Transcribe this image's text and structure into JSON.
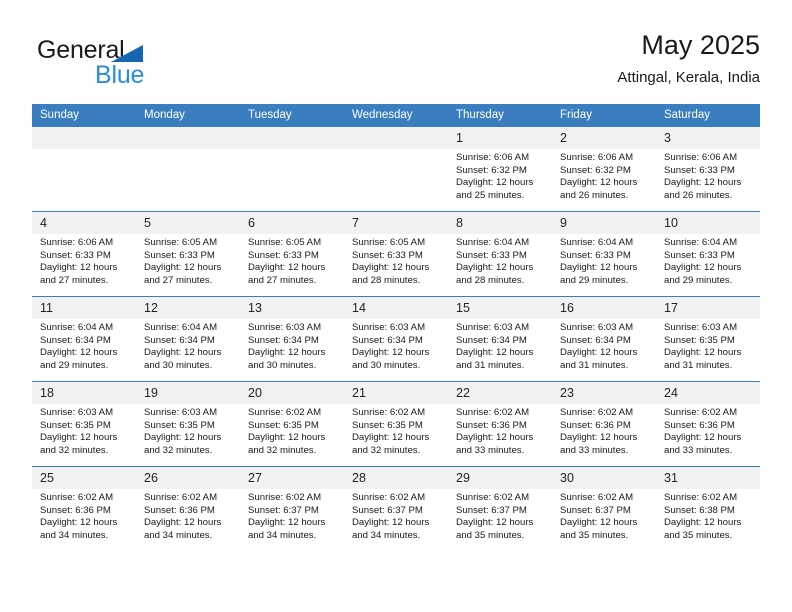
{
  "brand": {
    "name_top": "General",
    "name_bottom": "Blue",
    "accent_color": "#2a8ddb",
    "triangle_color": "#1565b0"
  },
  "header": {
    "title": "May 2025",
    "location": "Attingal, Kerala, India"
  },
  "calendar": {
    "header_bg": "#3a7ebf",
    "header_text_color": "#ffffff",
    "daynum_bg": "#f2f2f2",
    "weekdays": [
      "Sunday",
      "Monday",
      "Tuesday",
      "Wednesday",
      "Thursday",
      "Friday",
      "Saturday"
    ],
    "weeks": [
      [
        {
          "day": "",
          "empty": true
        },
        {
          "day": "",
          "empty": true
        },
        {
          "day": "",
          "empty": true
        },
        {
          "day": "",
          "empty": true
        },
        {
          "day": "1",
          "sunrise": "Sunrise: 6:06 AM",
          "sunset": "Sunset: 6:32 PM",
          "daylight_line1": "Daylight: 12 hours",
          "daylight_line2": "and 25 minutes."
        },
        {
          "day": "2",
          "sunrise": "Sunrise: 6:06 AM",
          "sunset": "Sunset: 6:32 PM",
          "daylight_line1": "Daylight: 12 hours",
          "daylight_line2": "and 26 minutes."
        },
        {
          "day": "3",
          "sunrise": "Sunrise: 6:06 AM",
          "sunset": "Sunset: 6:33 PM",
          "daylight_line1": "Daylight: 12 hours",
          "daylight_line2": "and 26 minutes."
        }
      ],
      [
        {
          "day": "4",
          "sunrise": "Sunrise: 6:06 AM",
          "sunset": "Sunset: 6:33 PM",
          "daylight_line1": "Daylight: 12 hours",
          "daylight_line2": "and 27 minutes."
        },
        {
          "day": "5",
          "sunrise": "Sunrise: 6:05 AM",
          "sunset": "Sunset: 6:33 PM",
          "daylight_line1": "Daylight: 12 hours",
          "daylight_line2": "and 27 minutes."
        },
        {
          "day": "6",
          "sunrise": "Sunrise: 6:05 AM",
          "sunset": "Sunset: 6:33 PM",
          "daylight_line1": "Daylight: 12 hours",
          "daylight_line2": "and 27 minutes."
        },
        {
          "day": "7",
          "sunrise": "Sunrise: 6:05 AM",
          "sunset": "Sunset: 6:33 PM",
          "daylight_line1": "Daylight: 12 hours",
          "daylight_line2": "and 28 minutes."
        },
        {
          "day": "8",
          "sunrise": "Sunrise: 6:04 AM",
          "sunset": "Sunset: 6:33 PM",
          "daylight_line1": "Daylight: 12 hours",
          "daylight_line2": "and 28 minutes."
        },
        {
          "day": "9",
          "sunrise": "Sunrise: 6:04 AM",
          "sunset": "Sunset: 6:33 PM",
          "daylight_line1": "Daylight: 12 hours",
          "daylight_line2": "and 29 minutes."
        },
        {
          "day": "10",
          "sunrise": "Sunrise: 6:04 AM",
          "sunset": "Sunset: 6:33 PM",
          "daylight_line1": "Daylight: 12 hours",
          "daylight_line2": "and 29 minutes."
        }
      ],
      [
        {
          "day": "11",
          "sunrise": "Sunrise: 6:04 AM",
          "sunset": "Sunset: 6:34 PM",
          "daylight_line1": "Daylight: 12 hours",
          "daylight_line2": "and 29 minutes."
        },
        {
          "day": "12",
          "sunrise": "Sunrise: 6:04 AM",
          "sunset": "Sunset: 6:34 PM",
          "daylight_line1": "Daylight: 12 hours",
          "daylight_line2": "and 30 minutes."
        },
        {
          "day": "13",
          "sunrise": "Sunrise: 6:03 AM",
          "sunset": "Sunset: 6:34 PM",
          "daylight_line1": "Daylight: 12 hours",
          "daylight_line2": "and 30 minutes."
        },
        {
          "day": "14",
          "sunrise": "Sunrise: 6:03 AM",
          "sunset": "Sunset: 6:34 PM",
          "daylight_line1": "Daylight: 12 hours",
          "daylight_line2": "and 30 minutes."
        },
        {
          "day": "15",
          "sunrise": "Sunrise: 6:03 AM",
          "sunset": "Sunset: 6:34 PM",
          "daylight_line1": "Daylight: 12 hours",
          "daylight_line2": "and 31 minutes."
        },
        {
          "day": "16",
          "sunrise": "Sunrise: 6:03 AM",
          "sunset": "Sunset: 6:34 PM",
          "daylight_line1": "Daylight: 12 hours",
          "daylight_line2": "and 31 minutes."
        },
        {
          "day": "17",
          "sunrise": "Sunrise: 6:03 AM",
          "sunset": "Sunset: 6:35 PM",
          "daylight_line1": "Daylight: 12 hours",
          "daylight_line2": "and 31 minutes."
        }
      ],
      [
        {
          "day": "18",
          "sunrise": "Sunrise: 6:03 AM",
          "sunset": "Sunset: 6:35 PM",
          "daylight_line1": "Daylight: 12 hours",
          "daylight_line2": "and 32 minutes."
        },
        {
          "day": "19",
          "sunrise": "Sunrise: 6:03 AM",
          "sunset": "Sunset: 6:35 PM",
          "daylight_line1": "Daylight: 12 hours",
          "daylight_line2": "and 32 minutes."
        },
        {
          "day": "20",
          "sunrise": "Sunrise: 6:02 AM",
          "sunset": "Sunset: 6:35 PM",
          "daylight_line1": "Daylight: 12 hours",
          "daylight_line2": "and 32 minutes."
        },
        {
          "day": "21",
          "sunrise": "Sunrise: 6:02 AM",
          "sunset": "Sunset: 6:35 PM",
          "daylight_line1": "Daylight: 12 hours",
          "daylight_line2": "and 32 minutes."
        },
        {
          "day": "22",
          "sunrise": "Sunrise: 6:02 AM",
          "sunset": "Sunset: 6:36 PM",
          "daylight_line1": "Daylight: 12 hours",
          "daylight_line2": "and 33 minutes."
        },
        {
          "day": "23",
          "sunrise": "Sunrise: 6:02 AM",
          "sunset": "Sunset: 6:36 PM",
          "daylight_line1": "Daylight: 12 hours",
          "daylight_line2": "and 33 minutes."
        },
        {
          "day": "24",
          "sunrise": "Sunrise: 6:02 AM",
          "sunset": "Sunset: 6:36 PM",
          "daylight_line1": "Daylight: 12 hours",
          "daylight_line2": "and 33 minutes."
        }
      ],
      [
        {
          "day": "25",
          "sunrise": "Sunrise: 6:02 AM",
          "sunset": "Sunset: 6:36 PM",
          "daylight_line1": "Daylight: 12 hours",
          "daylight_line2": "and 34 minutes."
        },
        {
          "day": "26",
          "sunrise": "Sunrise: 6:02 AM",
          "sunset": "Sunset: 6:36 PM",
          "daylight_line1": "Daylight: 12 hours",
          "daylight_line2": "and 34 minutes."
        },
        {
          "day": "27",
          "sunrise": "Sunrise: 6:02 AM",
          "sunset": "Sunset: 6:37 PM",
          "daylight_line1": "Daylight: 12 hours",
          "daylight_line2": "and 34 minutes."
        },
        {
          "day": "28",
          "sunrise": "Sunrise: 6:02 AM",
          "sunset": "Sunset: 6:37 PM",
          "daylight_line1": "Daylight: 12 hours",
          "daylight_line2": "and 34 minutes."
        },
        {
          "day": "29",
          "sunrise": "Sunrise: 6:02 AM",
          "sunset": "Sunset: 6:37 PM",
          "daylight_line1": "Daylight: 12 hours",
          "daylight_line2": "and 35 minutes."
        },
        {
          "day": "30",
          "sunrise": "Sunrise: 6:02 AM",
          "sunset": "Sunset: 6:37 PM",
          "daylight_line1": "Daylight: 12 hours",
          "daylight_line2": "and 35 minutes."
        },
        {
          "day": "31",
          "sunrise": "Sunrise: 6:02 AM",
          "sunset": "Sunset: 6:38 PM",
          "daylight_line1": "Daylight: 12 hours",
          "daylight_line2": "and 35 minutes."
        }
      ]
    ]
  }
}
